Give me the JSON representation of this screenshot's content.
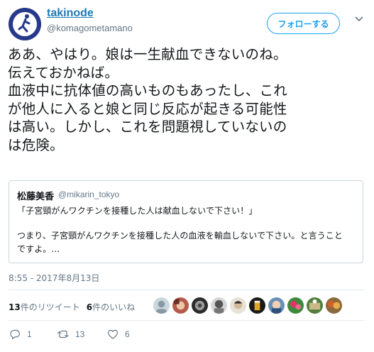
{
  "user": {
    "display_name": "takinode",
    "handle": "@komagometamano",
    "follow_label": "フォローする"
  },
  "tweet": {
    "lines": [
      "ああ、やはり。娘は一生献血できないのね。",
      "伝えておかねば。",
      "血液中に抗体値の高いものもあったし、これ",
      "が他人に入ると娘と同じ反応が起きる可能性",
      "は高い。しかし、これを問題視していないの",
      "は危険。"
    ]
  },
  "quote": {
    "display_name": "松藤美香",
    "handle": "@mikarin_tokyo",
    "lines": [
      "「子宮頸がんワクチンを接種した人は献血しないで下さい！」",
      "",
      "つまり、子宮頸がんワクチンを接種した人の血液を輸血しないで下さい。と言うこと",
      "ですよ。..."
    ]
  },
  "timestamp": "8:55 - 2017年8月13日",
  "stats": {
    "retweets_count": "13",
    "retweets_label": "件のリツイート",
    "likes_count": "6",
    "likes_label": "件のいいね"
  },
  "actions": {
    "reply_count": "1",
    "retweet_count": "13",
    "like_count": "6"
  },
  "colors": {
    "accent": "#1da1f2",
    "link": "#1d7ab3",
    "secondary_text": "#657786",
    "border": "#ccd6dd"
  }
}
